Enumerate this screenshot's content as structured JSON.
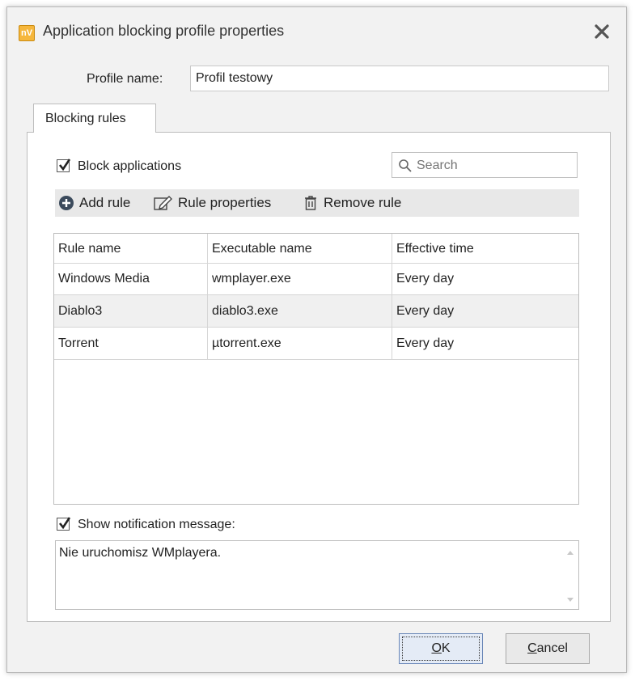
{
  "window": {
    "title": "Application blocking profile properties",
    "icon_text": "nV",
    "icon_color": "#f6b73c"
  },
  "profile": {
    "label": "Profile name:",
    "value": "Profil testowy"
  },
  "tabs": [
    {
      "label": "Blocking rules",
      "active": true
    }
  ],
  "block_applications": {
    "label": "Block applications",
    "checked": true
  },
  "search": {
    "placeholder": "Search",
    "icon": "search-icon"
  },
  "toolbar": {
    "add_label": "Add rule",
    "properties_label": "Rule properties",
    "remove_label": "Remove rule",
    "add_icon_color": "#3b4a5c"
  },
  "table": {
    "columns": [
      "Rule name",
      "Executable name",
      "Effective time"
    ],
    "rows": [
      {
        "name": "Windows Media",
        "exe": "wmplayer.exe",
        "time": "Every day"
      },
      {
        "name": "Diablo3",
        "exe": "diablo3.exe",
        "time": "Every day"
      },
      {
        "name": "Torrent",
        "exe": "µtorrent.exe",
        "time": "Every day"
      }
    ]
  },
  "notification": {
    "label": "Show notification message:",
    "checked": true,
    "message": "Nie uruchomisz WMplayera."
  },
  "buttons": {
    "ok_underlined": "O",
    "ok_rest": "K",
    "cancel_underlined": "C",
    "cancel_rest": "ancel"
  }
}
